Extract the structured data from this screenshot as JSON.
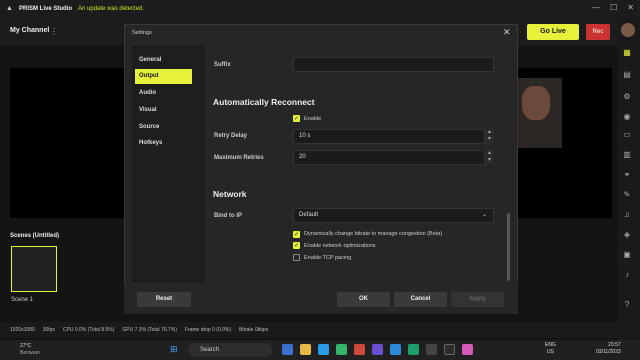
{
  "titlebar": {
    "app_title": "PRISM Live Studio",
    "update_message": "An update was detected.",
    "logo_icon": "prism-logo-icon",
    "controls": [
      "—",
      "☐",
      "✕"
    ]
  },
  "topbar": {
    "channel_label": "My Channel",
    "channel_menu": "⋮",
    "go_live_label": "Go Live",
    "rec_label": "Rec",
    "accent_color": "#e6f23a"
  },
  "scenes": {
    "title": "Scenes  (Untitled)",
    "items": [
      {
        "name": "Scene 1"
      }
    ]
  },
  "statusbar": {
    "resolution": "1920x1080",
    "fps": "30fps",
    "cpu": "CPU 0.0% (Total 8.5%)",
    "gpu": "GPU 7.3% (Total 76.7%)",
    "frame_drop": "Frame drop 0 (0.0%)",
    "bitrate": "Bitrate 0kbps"
  },
  "settings": {
    "title": "Settings",
    "close_icon": "close-icon",
    "nav": [
      "General",
      "Output",
      "Audio",
      "Visual",
      "Source",
      "Hotkeys"
    ],
    "active_nav": "Output",
    "suffix": {
      "label": "Suffix",
      "value": ""
    },
    "reconnect": {
      "heading": "Automatically Reconnect",
      "enable_label": "Enable",
      "enable_checked": true,
      "retry_delay_label": "Retry Delay",
      "retry_delay_value": "10 s",
      "max_retries_label": "Maximum Retries",
      "max_retries_value": "20"
    },
    "network": {
      "heading": "Network",
      "bind_label": "Bind to IP",
      "bind_value": "Default",
      "options": [
        {
          "label": "Dynamically change bitrate to manage congestion (Beta)",
          "checked": true
        },
        {
          "label": "Enable network optimizations",
          "checked": true
        },
        {
          "label": "Enable TCP pacing",
          "checked": false
        }
      ]
    },
    "buttons": {
      "reset": "Reset",
      "ok": "OK",
      "cancel": "Cancel",
      "apply": "Apply"
    }
  },
  "taskbar": {
    "weather_temp": "27°C",
    "weather_desc": "Berawan",
    "search_placeholder": "Search",
    "lang_line1": "ENG",
    "lang_line2": "US",
    "time": "23:57",
    "date": "03/11/2023"
  }
}
